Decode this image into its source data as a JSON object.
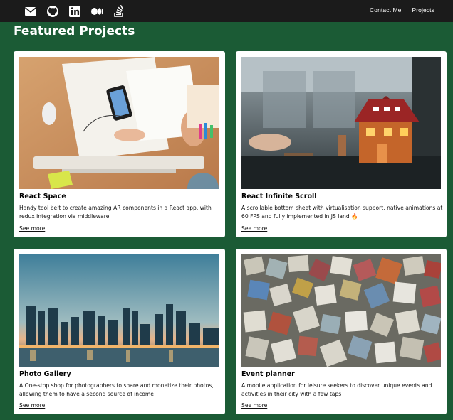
{
  "nav": {
    "icons": [
      "mail-icon",
      "github-icon",
      "linkedin-icon",
      "medium-icon",
      "stackoverflow-icon"
    ],
    "links": [
      "Contact Me",
      "Projects"
    ]
  },
  "page": {
    "title": "Featured Projects"
  },
  "colors": {
    "background": "#1b5b35",
    "topbar": "#1b1b1b",
    "card": "#ffffff"
  },
  "projects": [
    {
      "title": "React Space",
      "description": "Handy tool belt to create amazing AR components in a React app, with redux integration via middleware",
      "link": "See more",
      "image": "desk-with-phone-and-sketches"
    },
    {
      "title": "React Infinite Scroll",
      "description": "A scrollable bottom sheet with virtualisation support, native animations at 60 FPS and fully implemented in JS land 🔥",
      "link": "See more",
      "image": "miniature-house-model"
    },
    {
      "title": "Photo Gallery",
      "description": "A One-stop shop for photographers to share and monetize their photos, allowing them to have a second source of income",
      "link": "See more",
      "image": "city-skyline-at-dusk"
    },
    {
      "title": "Event planner",
      "description": "A mobile application for leisure seekers to discover unique events and activities in their city with a few taps",
      "link": "See more",
      "image": "colorful-stone-cubes"
    }
  ]
}
